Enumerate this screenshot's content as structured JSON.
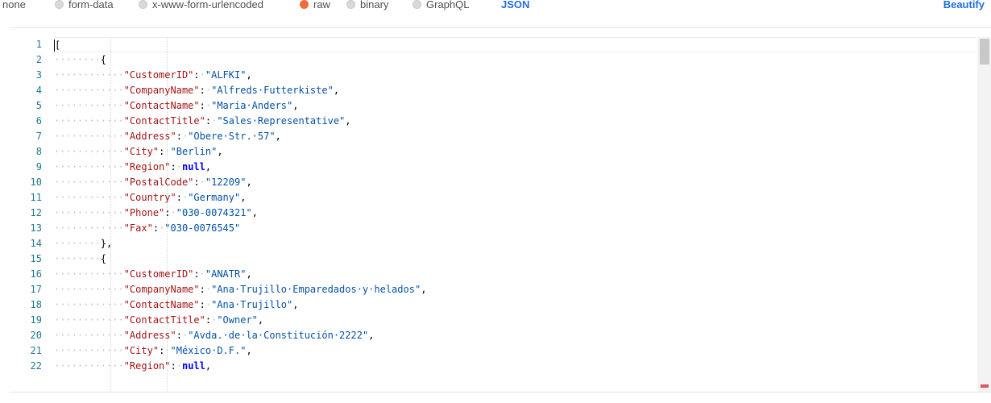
{
  "body_types": [
    {
      "label": "none",
      "selected": false
    },
    {
      "label": "form-data",
      "selected": false
    },
    {
      "label": "x-www-form-urlencoded",
      "selected": false
    },
    {
      "label": "raw",
      "selected": true
    },
    {
      "label": "binary",
      "selected": false
    },
    {
      "label": "GraphQL",
      "selected": false
    }
  ],
  "format": "JSON",
  "beautify": "Beautify",
  "accent_color": "#f26b3a",
  "link_color": "#1f6fe0",
  "line_numbers": [
    "1",
    "2",
    "3",
    "4",
    "5",
    "6",
    "7",
    "8",
    "9",
    "10",
    "11",
    "12",
    "13",
    "14",
    "15",
    "16",
    "17",
    "18",
    "19",
    "20",
    "21",
    "22"
  ],
  "code_lines": [
    [
      {
        "t": "[",
        "c": "brace"
      }
    ],
    [
      {
        "t": "{",
        "c": "brace"
      }
    ],
    [
      {
        "t": "\"CustomerID\"",
        "c": "key"
      },
      {
        "t": ": ",
        "c": "punc"
      },
      {
        "t": "\"ALFKI\"",
        "c": "str"
      },
      {
        "t": ",",
        "c": "punc"
      }
    ],
    [
      {
        "t": "\"CompanyName\"",
        "c": "key"
      },
      {
        "t": ": ",
        "c": "punc"
      },
      {
        "t": "\"Alfreds Futterkiste\"",
        "c": "str"
      },
      {
        "t": ",",
        "c": "punc"
      }
    ],
    [
      {
        "t": "\"ContactName\"",
        "c": "key"
      },
      {
        "t": ": ",
        "c": "punc"
      },
      {
        "t": "\"Maria Anders\"",
        "c": "str"
      },
      {
        "t": ",",
        "c": "punc"
      }
    ],
    [
      {
        "t": "\"ContactTitle\"",
        "c": "key"
      },
      {
        "t": ": ",
        "c": "punc"
      },
      {
        "t": "\"Sales Representative\"",
        "c": "str"
      },
      {
        "t": ",",
        "c": "punc"
      }
    ],
    [
      {
        "t": "\"Address\"",
        "c": "key"
      },
      {
        "t": ": ",
        "c": "punc"
      },
      {
        "t": "\"Obere Str. 57\"",
        "c": "str"
      },
      {
        "t": ",",
        "c": "punc"
      }
    ],
    [
      {
        "t": "\"City\"",
        "c": "key"
      },
      {
        "t": ": ",
        "c": "punc"
      },
      {
        "t": "\"Berlin\"",
        "c": "str"
      },
      {
        "t": ",",
        "c": "punc"
      }
    ],
    [
      {
        "t": "\"Region\"",
        "c": "key"
      },
      {
        "t": ": ",
        "c": "punc"
      },
      {
        "t": "null",
        "c": "kw"
      },
      {
        "t": ",",
        "c": "punc"
      }
    ],
    [
      {
        "t": "\"PostalCode\"",
        "c": "key"
      },
      {
        "t": ": ",
        "c": "punc"
      },
      {
        "t": "\"12209\"",
        "c": "str"
      },
      {
        "t": ",",
        "c": "punc"
      }
    ],
    [
      {
        "t": "\"Country\"",
        "c": "key"
      },
      {
        "t": ": ",
        "c": "punc"
      },
      {
        "t": "\"Germany\"",
        "c": "str"
      },
      {
        "t": ",",
        "c": "punc"
      }
    ],
    [
      {
        "t": "\"Phone\"",
        "c": "key"
      },
      {
        "t": ": ",
        "c": "punc"
      },
      {
        "t": "\"030-0074321\"",
        "c": "str"
      },
      {
        "t": ",",
        "c": "punc"
      }
    ],
    [
      {
        "t": "\"Fax\"",
        "c": "key"
      },
      {
        "t": ": ",
        "c": "punc"
      },
      {
        "t": "\"030-0076545\"",
        "c": "str"
      }
    ],
    [
      {
        "t": "}",
        "c": "brace"
      },
      {
        "t": ",",
        "c": "punc"
      }
    ],
    [
      {
        "t": "{",
        "c": "brace"
      }
    ],
    [
      {
        "t": "\"CustomerID\"",
        "c": "key"
      },
      {
        "t": ": ",
        "c": "punc"
      },
      {
        "t": "\"ANATR\"",
        "c": "str"
      },
      {
        "t": ",",
        "c": "punc"
      }
    ],
    [
      {
        "t": "\"CompanyName\"",
        "c": "key"
      },
      {
        "t": ": ",
        "c": "punc"
      },
      {
        "t": "\"Ana Trujillo Emparedados y helados\"",
        "c": "str"
      },
      {
        "t": ",",
        "c": "punc"
      }
    ],
    [
      {
        "t": "\"ContactName\"",
        "c": "key"
      },
      {
        "t": ": ",
        "c": "punc"
      },
      {
        "t": "\"Ana Trujillo\"",
        "c": "str"
      },
      {
        "t": ",",
        "c": "punc"
      }
    ],
    [
      {
        "t": "\"ContactTitle\"",
        "c": "key"
      },
      {
        "t": ": ",
        "c": "punc"
      },
      {
        "t": "\"Owner\"",
        "c": "str"
      },
      {
        "t": ",",
        "c": "punc"
      }
    ],
    [
      {
        "t": "\"Address\"",
        "c": "key"
      },
      {
        "t": ": ",
        "c": "punc"
      },
      {
        "t": "\"Avda. de la Constitución 2222\"",
        "c": "str"
      },
      {
        "t": ",",
        "c": "punc"
      }
    ],
    [
      {
        "t": "\"City\"",
        "c": "key"
      },
      {
        "t": ": ",
        "c": "punc"
      },
      {
        "t": "\"México D.F.\"",
        "c": "str"
      },
      {
        "t": ",",
        "c": "punc"
      }
    ],
    [
      {
        "t": "\"Region\"",
        "c": "key"
      },
      {
        "t": ": ",
        "c": "punc"
      },
      {
        "t": "null",
        "c": "kw"
      },
      {
        "t": ",",
        "c": "punc"
      }
    ]
  ]
}
